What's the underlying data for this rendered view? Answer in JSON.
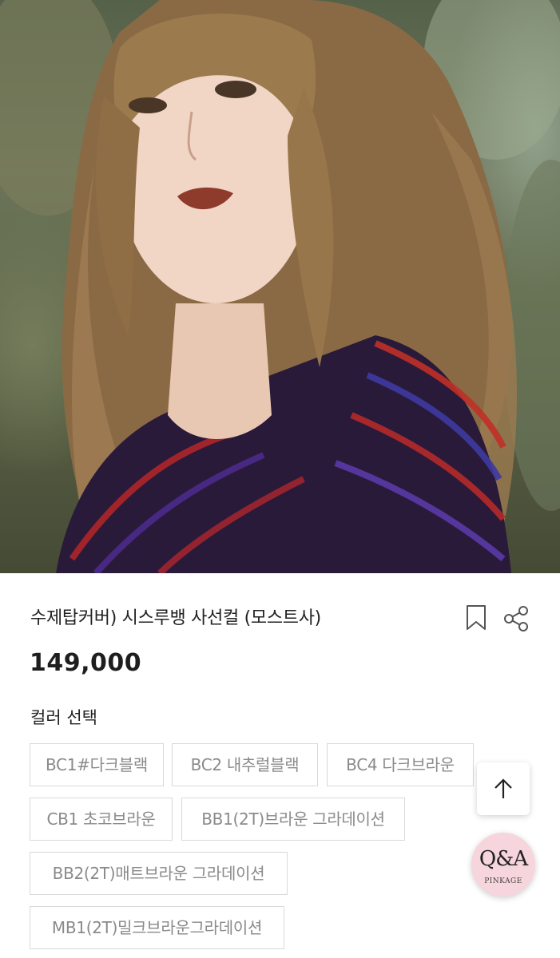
{
  "product": {
    "image_alt": "model with long wavy light brown hair",
    "title": "수제탑커버) 시스루뱅 사선컬 (모스트사)",
    "price": "149,000"
  },
  "actions": {
    "bookmark_icon": "bookmark-icon",
    "share_icon": "share-icon"
  },
  "options": {
    "label": "컬러 선택",
    "colors": [
      "BC1#다크블랙",
      "BC2 내추럴블랙",
      "BC4 다크브라운",
      "CB1 초코브라운",
      "BB1(2T)브라운 그라데이션",
      "BB2(2T)매트브라운 그라데이션",
      "MB1(2T)밀크브라운그라데이션"
    ]
  },
  "floating": {
    "scroll_top_icon": "arrow-up-icon",
    "qa_title": "Q&A",
    "qa_brand": "PINKAGE"
  },
  "colors": {
    "chip_border": "#d9d9d9",
    "chip_text": "#8a8a8a",
    "qa_badge_bg": "#f7d5dc"
  }
}
